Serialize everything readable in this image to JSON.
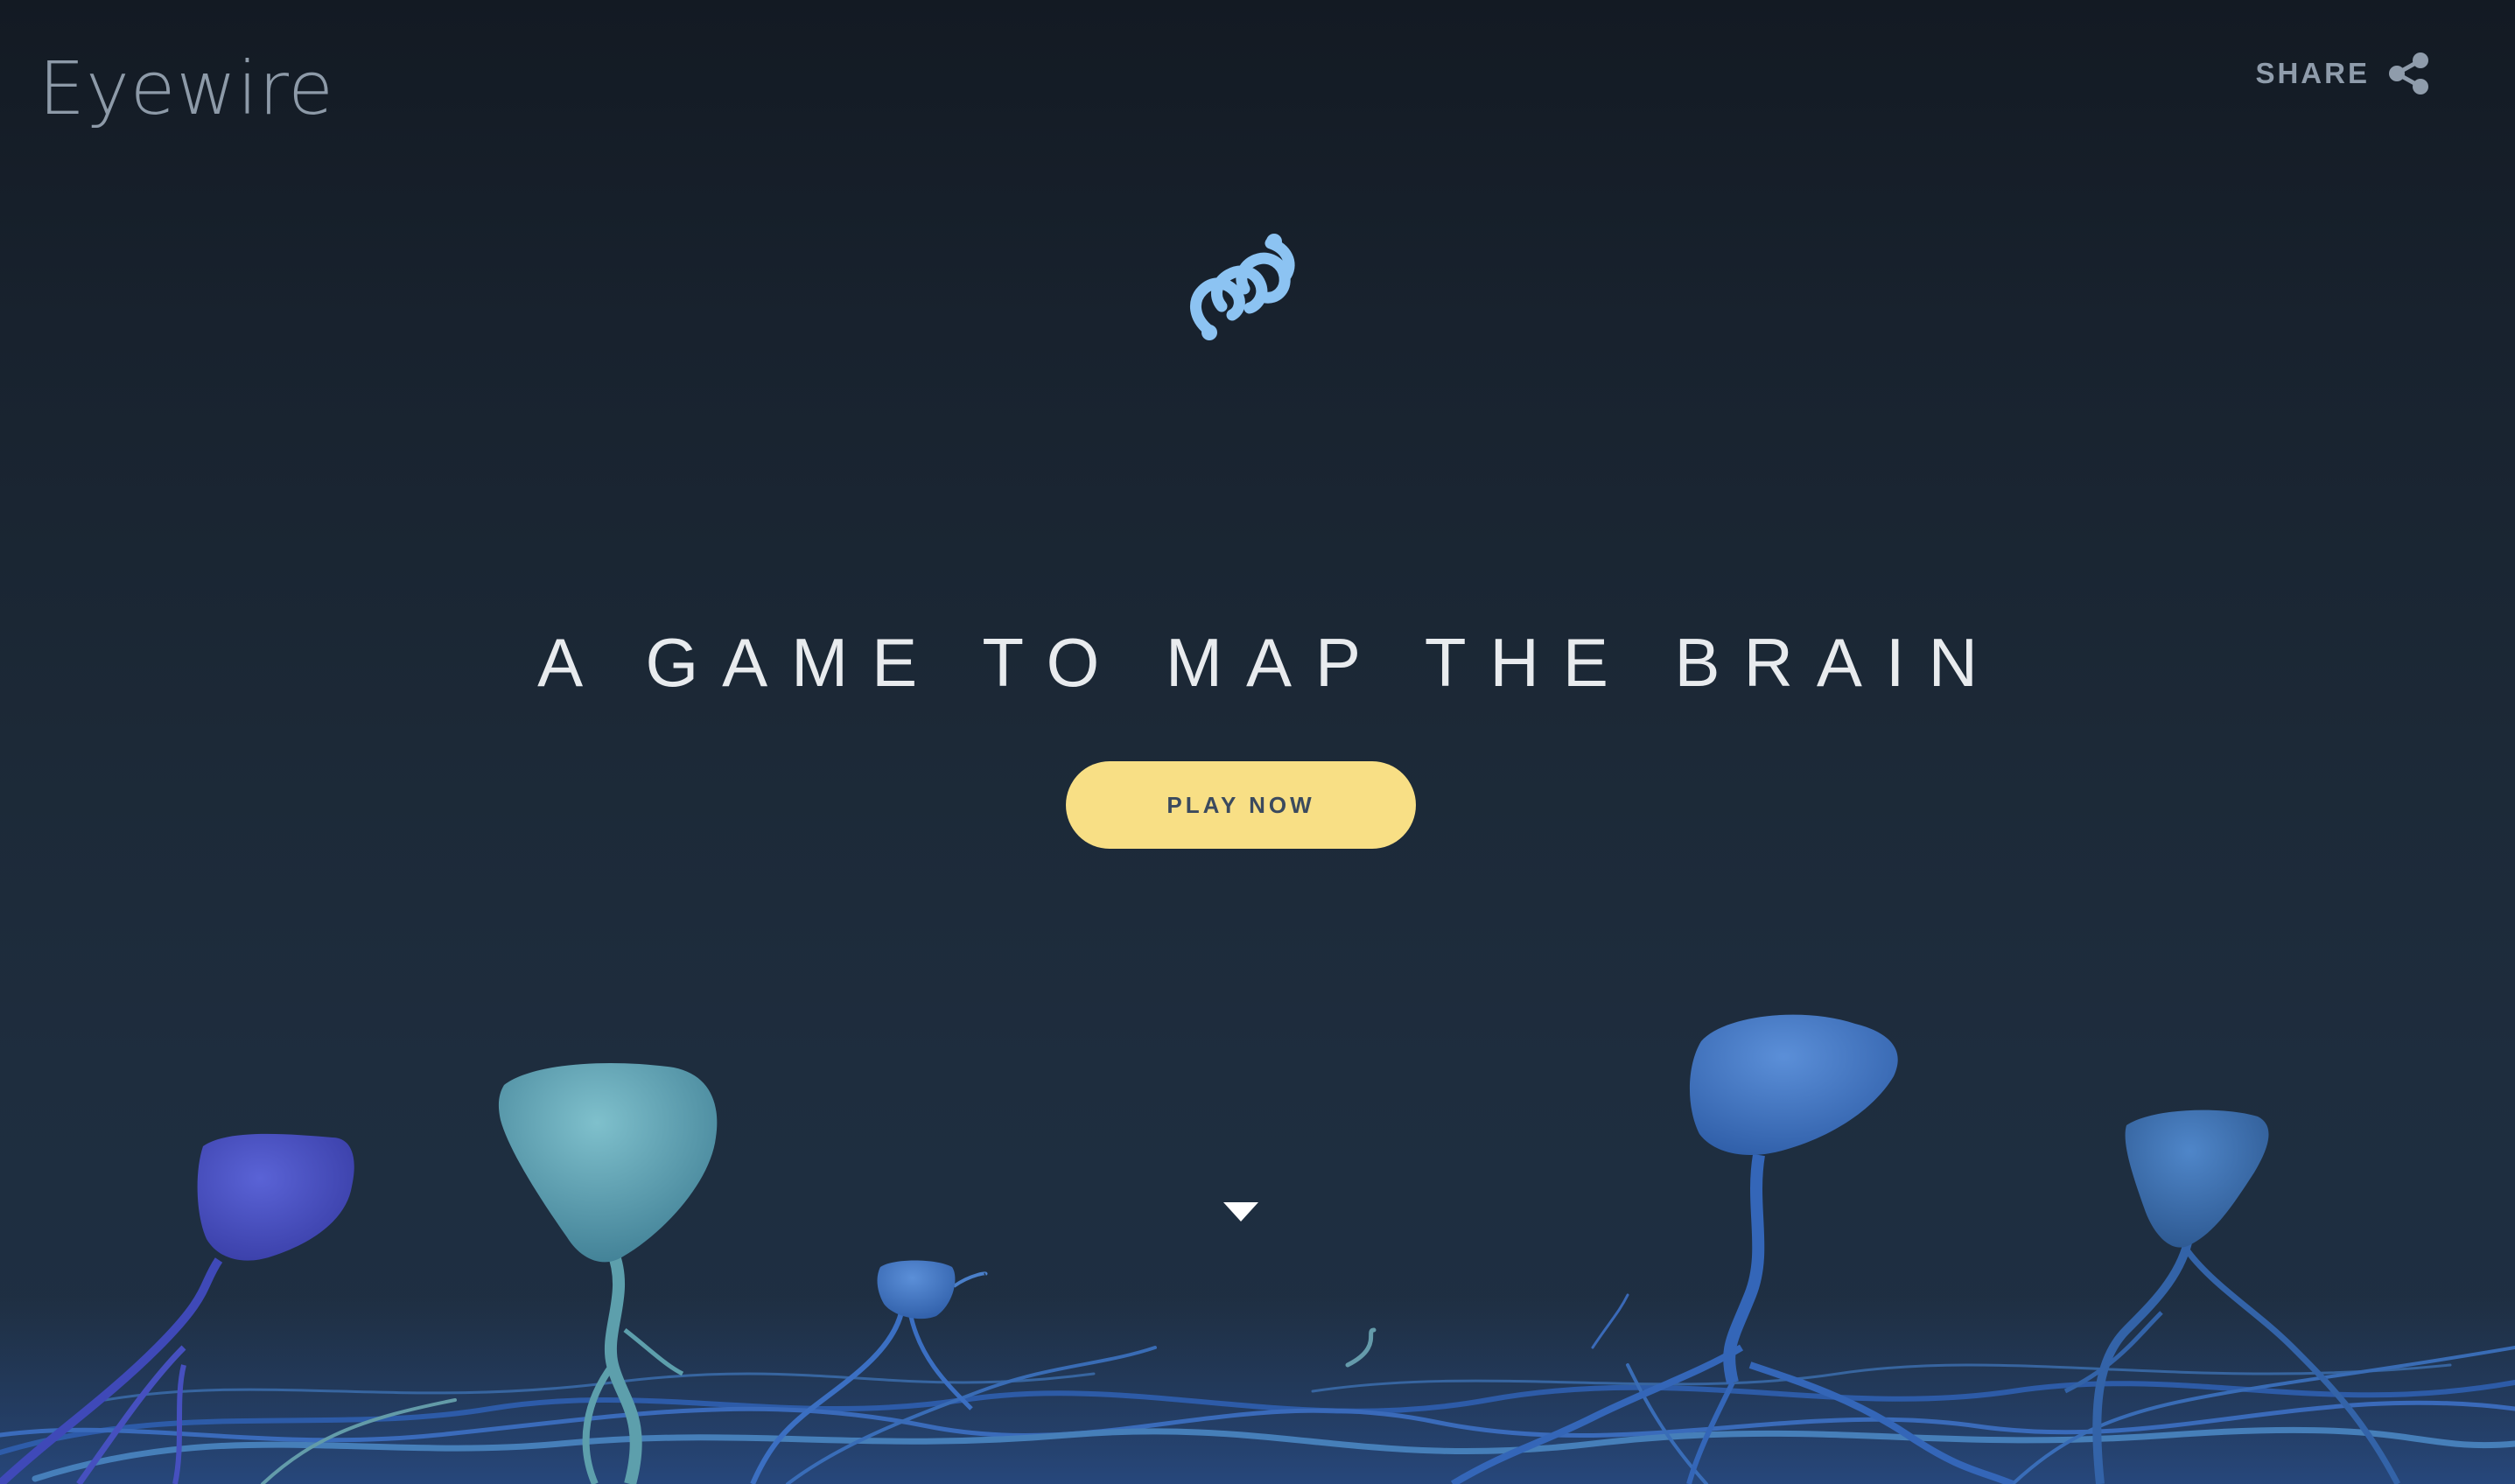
{
  "header": {
    "logo_text": "Eyewire",
    "share_label": "SHARE",
    "share_icon": "share-icon"
  },
  "hero": {
    "brand_mark_icon": "eyewire-mark-icon",
    "headline": "A GAME TO MAP THE BRAIN",
    "play_button_label": "PLAY NOW",
    "scroll_icon": "chevron-down-icon"
  },
  "colors": {
    "background_top": "#131a23",
    "background_bottom": "#1f3045",
    "text_primary": "#e8ebee",
    "text_muted": "#8f9cab",
    "button_bg": "#f8df85",
    "button_text": "#3b4a5e",
    "brand_mark": "#8cc3f2",
    "neuron_teal": "#5fa3b5",
    "neuron_blue": "#3f6fbf",
    "neuron_violet": "#4b53c4"
  }
}
